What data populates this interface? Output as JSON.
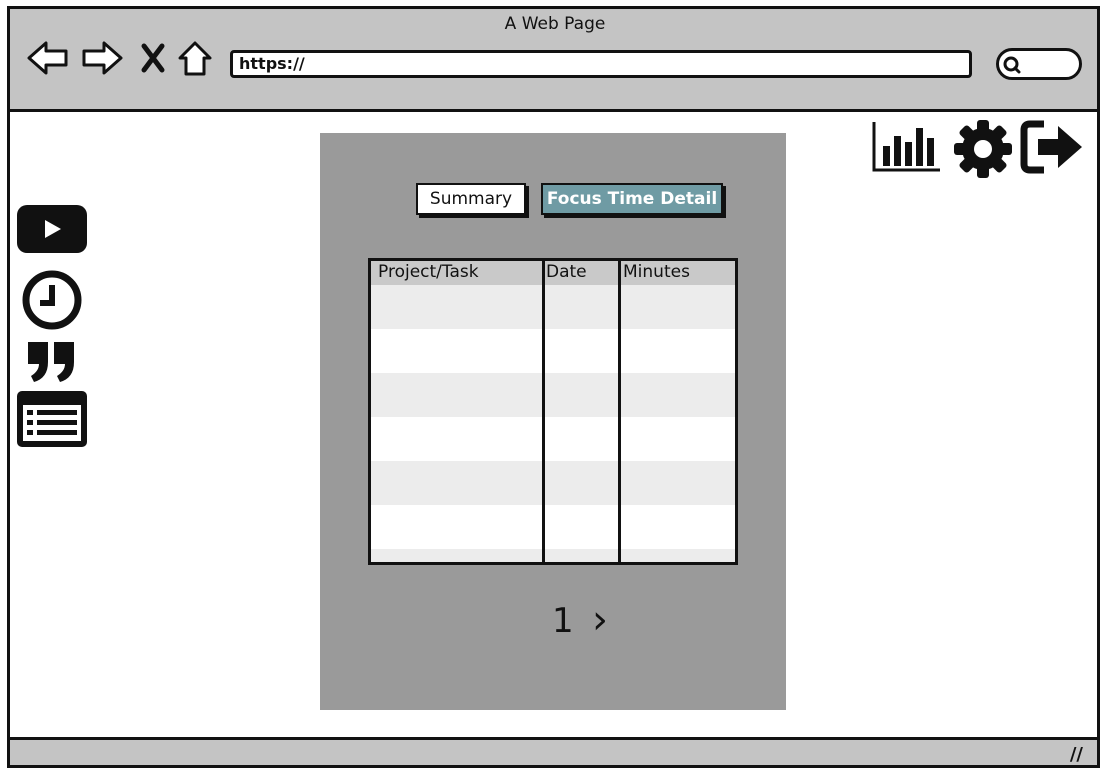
{
  "window": {
    "title": "A Web Page",
    "url": "https://"
  },
  "toolbar": {
    "nav_icons": [
      "back-arrow-icon",
      "forward-arrow-icon",
      "close-x-icon",
      "home-icon"
    ],
    "search_icon": "search-icon"
  },
  "header_actions": {
    "icons": [
      "bar-chart-icon",
      "gear-icon",
      "logout-icon"
    ]
  },
  "sidebar": {
    "icons": [
      "play-button-icon",
      "clock-icon",
      "quote-icon",
      "list-icon"
    ]
  },
  "tabs": [
    {
      "label": "Summary",
      "active": false
    },
    {
      "label": "Focus Time Detail",
      "active": true
    }
  ],
  "table": {
    "headers": [
      "Project/Task",
      "Date",
      "Minutes"
    ],
    "rows": []
  },
  "pagination": {
    "current_page": "1",
    "next_symbol": "›"
  },
  "colors": {
    "active_tab": "#6f9ba4",
    "panel": "#9a9a9a",
    "chrome": "#c4c4c4"
  }
}
